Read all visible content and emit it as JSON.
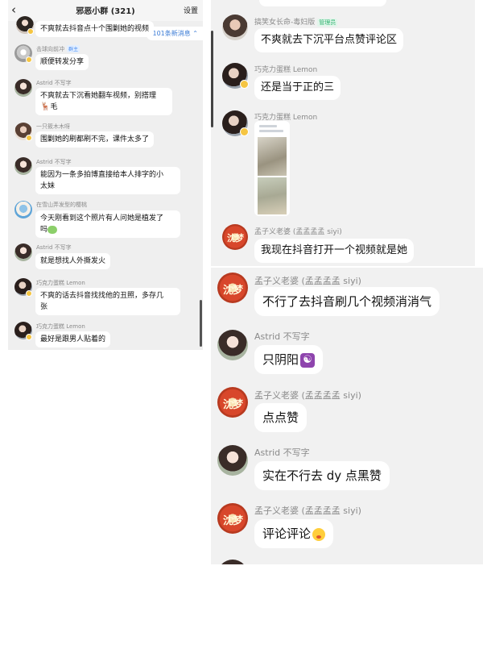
{
  "header": {
    "back_icon": "chevron-left-icon",
    "title": "邪恶小群 (321)",
    "settings_label": "设置"
  },
  "new_messages_label": "101条新消息 ⌃",
  "panel1_messages": [
    {
      "sender": "",
      "text": "不爽就去抖音点十个围剿她的视频"
    },
    {
      "sender": "击球向前冲",
      "tag": "群主",
      "text": "顺便转发分享"
    },
    {
      "sender": "Astrid 不写字",
      "text": "不爽就去下沉看她翻车视频，别搭理",
      "text2": "毛"
    },
    {
      "sender": "一只筱木木呀",
      "text": "围剿她的刷都刷不完，课件太多了"
    },
    {
      "sender": "Astrid 不写字",
      "text": "能因为一条多拍博直接给本人排字的小",
      "text2": "太妹"
    },
    {
      "sender": "在雪山弄发型的樱桃",
      "text": "今天刚看到这个照片有人问她是植发了",
      "text2": "吗"
    },
    {
      "sender": "Astrid 不写字",
      "text": "就是想找人外撕发火"
    },
    {
      "sender": "巧克力蛋糕 Lemon",
      "text": "不爽的话去抖音找找他的丑照，多存几",
      "text2": "张"
    },
    {
      "sender": "巧克力蛋糕 Lemon",
      "text": "最好是跟男人贴着的"
    }
  ],
  "panel2_messages": [
    {
      "sender": "搞笑女长命-毒妇版",
      "tag": "管理员",
      "text": "不爽就去下沉平台点赞评论区"
    },
    {
      "sender": "巧克力蛋糕 Lemon",
      "text": "还是当于正的三"
    },
    {
      "sender": "巧克力蛋糕 Lemon",
      "text": ""
    },
    {
      "sender": "孟子义老婆 (孟孟孟孟 siyi)",
      "text": "我现在抖音打开一个视频就是她"
    }
  ],
  "panel3_messages": [
    {
      "sender": "孟子义老婆 (孟孟孟孟 siyi)",
      "text": "不行了去抖音刷几个视频消消气"
    },
    {
      "sender": "Astrid 不写字",
      "text": "只阴阳",
      "emoji": "yin-yang-emoji"
    },
    {
      "sender": "孟子义老婆 (孟孟孟孟 siyi)",
      "text": "点点赞"
    },
    {
      "sender": "Astrid 不写字",
      "text": "实在不行去 dy 点黑赞"
    },
    {
      "sender": "孟子义老婆 (孟孟孟孟 siyi)",
      "text": "评论评论",
      "emoji": "face-emoji"
    }
  ],
  "seal_text": "沈梦",
  "colors": {
    "panel_bg": "#efefef",
    "bubble": "#ffffff",
    "link_blue": "#3a7bd5",
    "admin_green": "#2fb36f"
  }
}
